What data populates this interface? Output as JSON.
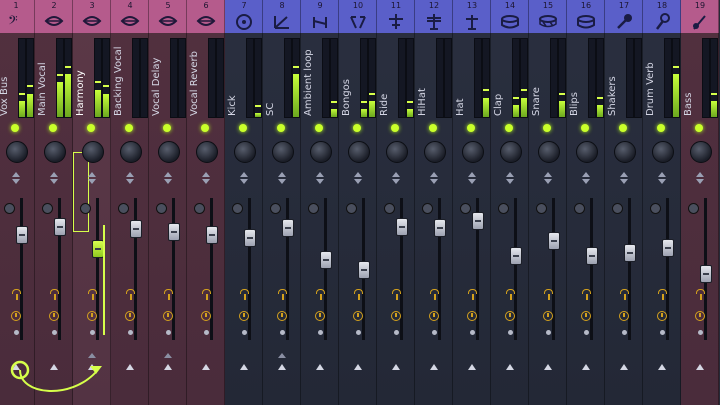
{
  "colors": {
    "pink_group": "#b55b8c",
    "blue_group": "#5a5fc9",
    "meter": "#c7ff3a",
    "send": "#d5a21d"
  },
  "channels": [
    {
      "number": "1",
      "name": "Vox Bus",
      "icon": "bass-clef-icon",
      "group": "pink",
      "meter": [
        0.2,
        0.3
      ],
      "fader": 0.8
    },
    {
      "number": "2",
      "name": "Main Vocal",
      "icon": "lips-icon",
      "group": "pink",
      "meter": [
        0.45,
        0.55
      ],
      "fader": 0.86
    },
    {
      "number": "3",
      "name": "Harmony",
      "icon": "lips-icon",
      "group": "pink",
      "meter": [
        0.35,
        0.3
      ],
      "fader": 0.7,
      "selected": true
    },
    {
      "number": "4",
      "name": "Backing Vocal",
      "icon": "lips-icon",
      "group": "pink",
      "meter": [
        0,
        0
      ],
      "fader": 0.84
    },
    {
      "number": "5",
      "name": "Vocal Delay",
      "icon": "lips-icon",
      "group": "pink",
      "meter": [
        0,
        0
      ],
      "fader": 0.82
    },
    {
      "number": "6",
      "name": "Vocal Reverb",
      "icon": "lips-icon",
      "group": "pink",
      "meter": [
        0,
        0
      ],
      "fader": 0.8
    },
    {
      "number": "7",
      "name": "Kick",
      "icon": "kick-drum-icon",
      "group": "blue",
      "meter": [
        0,
        0.05
      ],
      "fader": 0.78
    },
    {
      "number": "8",
      "name": "SC",
      "icon": "sidechain-icon",
      "group": "blue",
      "meter": [
        0,
        0.55
      ],
      "fader": 0.85
    },
    {
      "number": "9",
      "name": "Ambient loop",
      "icon": "loop-icon",
      "group": "blue",
      "meter": [
        0,
        0.1
      ],
      "fader": 0.62
    },
    {
      "number": "10",
      "name": "Bongos",
      "icon": "bongos-icon",
      "group": "blue",
      "meter": [
        0.1,
        0.2
      ],
      "fader": 0.55
    },
    {
      "number": "11",
      "name": "Ride",
      "icon": "cymbal-icon",
      "group": "blue",
      "meter": [
        0,
        0.1
      ],
      "fader": 0.86
    },
    {
      "number": "12",
      "name": "HiHat",
      "icon": "hihat-icon",
      "group": "blue",
      "meter": [
        0,
        0
      ],
      "fader": 0.85
    },
    {
      "number": "13",
      "name": "Hat",
      "icon": "hat-icon",
      "group": "blue",
      "meter": [
        0,
        0.25
      ],
      "fader": 0.9
    },
    {
      "number": "14",
      "name": "Clap",
      "icon": "drum-icon",
      "group": "blue",
      "meter": [
        0.15,
        0.25
      ],
      "fader": 0.65
    },
    {
      "number": "15",
      "name": "Snare",
      "icon": "snare-icon",
      "group": "blue",
      "meter": [
        0,
        0.2
      ],
      "fader": 0.76
    },
    {
      "number": "16",
      "name": "Blips",
      "icon": "drum-icon",
      "group": "blue",
      "meter": [
        0,
        0.15
      ],
      "fader": 0.65
    },
    {
      "number": "17",
      "name": "Shakers",
      "icon": "shaker-icon",
      "group": "blue",
      "meter": [
        0,
        0
      ],
      "fader": 0.67
    },
    {
      "number": "18",
      "name": "Drum Verb",
      "icon": "microphone-icon",
      "group": "blue",
      "meter": [
        0,
        0.55
      ],
      "fader": 0.71
    },
    {
      "number": "19",
      "name": "Bass",
      "icon": "bass-icon",
      "group": "bass",
      "meter": [
        0,
        0.2
      ],
      "fader": 0.52
    }
  ]
}
